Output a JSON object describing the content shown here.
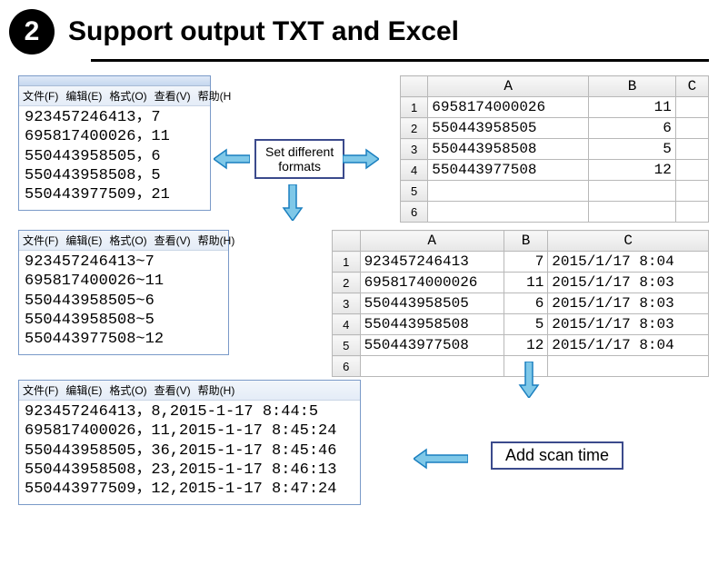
{
  "step_number": "2",
  "title": "Support output TXT and Excel",
  "menus": {
    "file": "文件(F)",
    "edit": "编辑(E)",
    "format": "格式(O)",
    "view": "查看(V)",
    "help": "帮助(H",
    "help_full": "帮助(H)"
  },
  "txt1": {
    "lines": [
      "923457246413，7",
      "695817400026，11",
      "550443958505，6",
      "550443958508，5",
      "550443977509，21"
    ]
  },
  "txt2": {
    "lines": [
      "923457246413~7",
      "695817400026~11",
      "550443958505~6",
      "550443958508~5",
      "550443977508~12"
    ]
  },
  "txt3": {
    "lines": [
      "923457246413，8,2015-1-17 8:44:5",
      "695817400026，11,2015-1-17 8:45:24",
      "550443958505，36,2015-1-17 8:45:46",
      "550443958508，23,2015-1-17 8:46:13",
      "550443977509，12,2015-1-17 8:47:24"
    ]
  },
  "excel1": {
    "cols": [
      "",
      "A",
      "B",
      "C"
    ],
    "rows": [
      {
        "n": "1",
        "a": "6958174000026",
        "b": "11"
      },
      {
        "n": "2",
        "a": "550443958505",
        "b": "6"
      },
      {
        "n": "3",
        "a": "550443958508",
        "b": "5"
      },
      {
        "n": "4",
        "a": "550443977508",
        "b": "12"
      },
      {
        "n": "5",
        "a": "",
        "b": ""
      },
      {
        "n": "6",
        "a": "",
        "b": ""
      }
    ]
  },
  "excel2": {
    "cols": [
      "",
      "A",
      "B",
      "C"
    ],
    "rows": [
      {
        "n": "1",
        "a": "923457246413",
        "b": "7",
        "c": "2015/1/17 8:04"
      },
      {
        "n": "2",
        "a": "6958174000026",
        "b": "11",
        "c": "2015/1/17 8:03"
      },
      {
        "n": "3",
        "a": "550443958505",
        "b": "6",
        "c": "2015/1/17 8:03"
      },
      {
        "n": "4",
        "a": "550443958508",
        "b": "5",
        "c": "2015/1/17 8:03"
      },
      {
        "n": "5",
        "a": "550443977508",
        "b": "12",
        "c": "2015/1/17 8:04"
      },
      {
        "n": "6",
        "a": "",
        "b": "",
        "c": ""
      }
    ]
  },
  "callouts": {
    "set_formats_l1": "Set different",
    "set_formats_l2": "formats",
    "add_scan": "Add scan time"
  }
}
